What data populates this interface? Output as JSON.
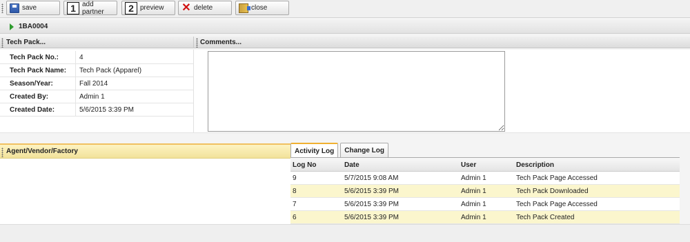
{
  "toolbar": {
    "save_label": "save",
    "add_partner_label": "add partner",
    "add_partner_badge": "1",
    "preview_label": "preview",
    "preview_badge": "2",
    "delete_label": "delete",
    "close_label": "close"
  },
  "record": {
    "id": "1BA0004"
  },
  "techpack": {
    "title": "Tech Pack...",
    "rows": [
      {
        "label": "Tech Pack No.:",
        "value": "4"
      },
      {
        "label": "Tech Pack Name:",
        "value": "Tech Pack (Apparel)"
      },
      {
        "label": "Season/Year:",
        "value": "Fall 2014"
      },
      {
        "label": "Created By:",
        "value": "Admin 1"
      },
      {
        "label": "Created Date:",
        "value": "5/6/2015 3:39 PM"
      }
    ]
  },
  "comments": {
    "title": "Comments...",
    "value": ""
  },
  "agent": {
    "title": "Agent/Vendor/Factory"
  },
  "tabs": [
    {
      "label": "Activity Log",
      "active": true
    },
    {
      "label": "Change Log",
      "active": false
    }
  ],
  "log": {
    "columns": [
      "Log No",
      "Date",
      "User",
      "Description"
    ],
    "rows": [
      [
        "9",
        "5/7/2015 9:08 AM",
        "Admin 1",
        "Tech Pack Page Accessed"
      ],
      [
        "8",
        "5/6/2015 3:39 PM",
        "Admin 1",
        "Tech Pack Downloaded"
      ],
      [
        "7",
        "5/6/2015 3:39 PM",
        "Admin 1",
        "Tech Pack Page Accessed"
      ],
      [
        "6",
        "5/6/2015 3:39 PM",
        "Admin 1",
        "Tech Pack Created"
      ]
    ]
  },
  "colors": {
    "highlight_row": "#fbf6cd",
    "section_accent": "#f0c060",
    "play_icon": "#2e9b2e",
    "delete_icon": "#d01010"
  }
}
